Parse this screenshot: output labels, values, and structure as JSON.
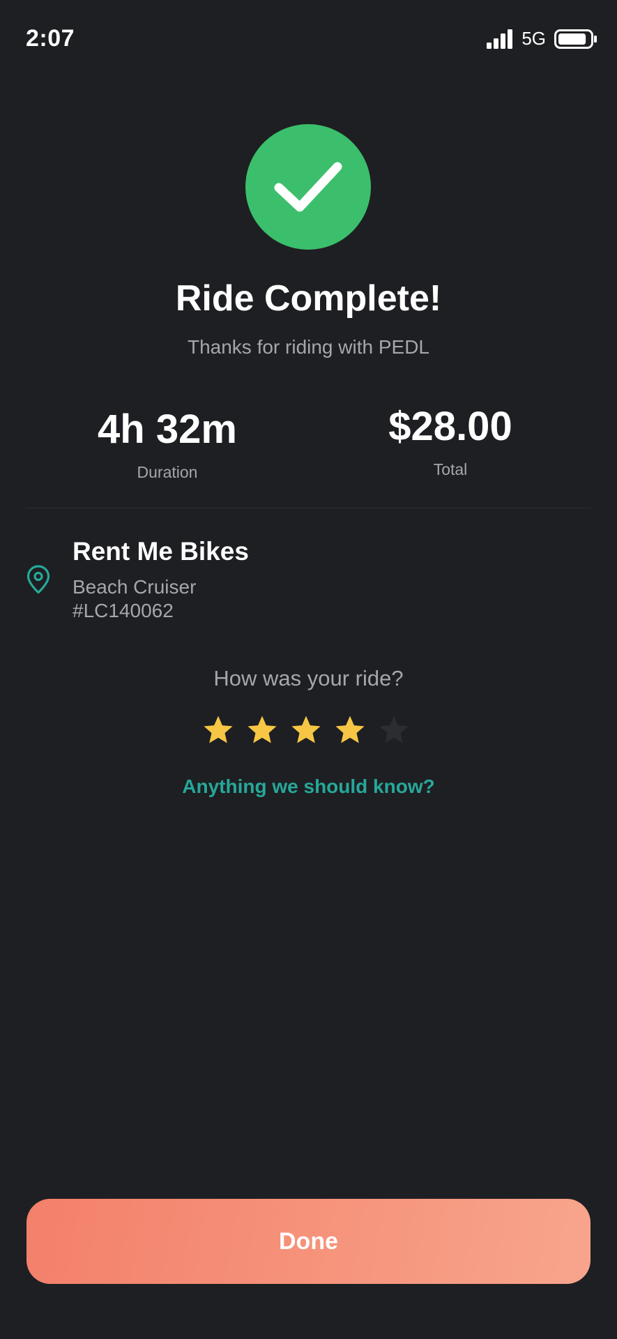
{
  "status_bar": {
    "time": "2:07",
    "network": "5G",
    "signal_icon": "signal-bars-icon",
    "battery_icon": "battery-icon",
    "battery_level": 0.85
  },
  "header": {
    "icon": "checkmark-icon",
    "badge_color": "#3bbf6c",
    "title": "Ride Complete!",
    "subtitle": "Thanks for riding with PEDL"
  },
  "stats": {
    "duration": {
      "value": "4h 32m",
      "label": "Duration"
    },
    "total": {
      "value": "$28.00",
      "label": "Total"
    }
  },
  "rental": {
    "icon": "location-pin-icon",
    "vendor": "Rent Me Bikes",
    "bike_model": "Beach Cruiser",
    "bike_id": "#LC140062"
  },
  "rating": {
    "prompt": "How was your ride?",
    "value": 4,
    "max": 5,
    "star_icon": "star-icon",
    "filled_color": "#f6c644",
    "empty_color": "#2c2d31"
  },
  "feedback": {
    "label": "Anything we should know?",
    "color": "#26a89a"
  },
  "actions": {
    "done_label": "Done"
  },
  "colors": {
    "background": "#1e1f22",
    "accent_gradient_start": "#f3806a",
    "accent_gradient_end": "#f8a58d",
    "secondary_text": "#a6a7ab"
  }
}
